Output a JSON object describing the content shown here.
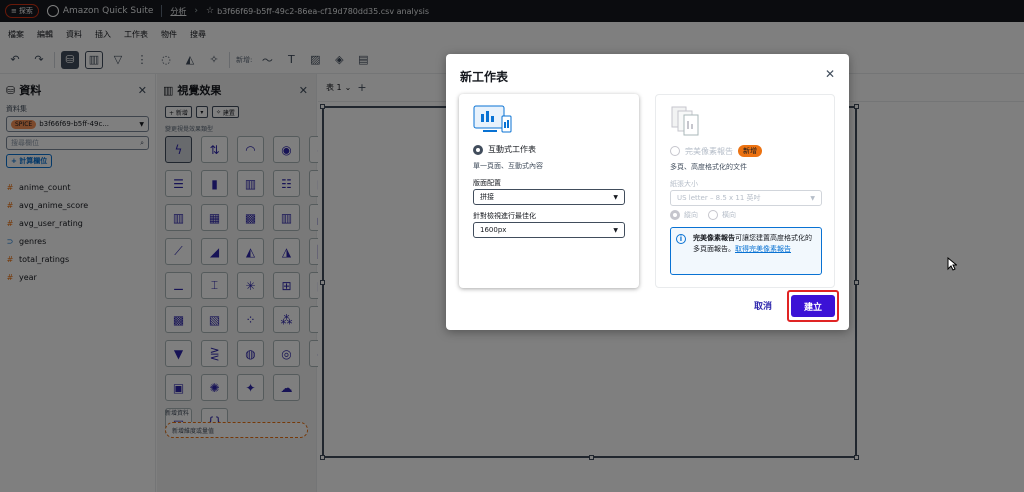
{
  "topbar": {
    "search_label": "探索",
    "brand": "Amazon Quick Suite",
    "crumb_link": "分析",
    "crumb_file": "b3f66f69-b5ff-49c2-86ea-cf19d780dd35.csv analysis"
  },
  "menubar": [
    "檔案",
    "編輯",
    "資料",
    "插入",
    "工作表",
    "物件",
    "搜尋"
  ],
  "toolbar": {
    "new_label": "新增:"
  },
  "data_panel": {
    "title": "資料",
    "dataset_label": "資料集",
    "spice": "SPICE",
    "dataset_name": "b3f66f69-b5ff-49c...",
    "search_placeholder": "搜尋欄位",
    "add_calc": "+ 計算欄位",
    "fields": [
      {
        "name": "anime_count",
        "kind": "measure"
      },
      {
        "name": "avg_anime_score",
        "kind": "measure"
      },
      {
        "name": "avg_user_rating",
        "kind": "measure"
      },
      {
        "name": "genres",
        "kind": "dimension"
      },
      {
        "name": "total_ratings",
        "kind": "measure"
      },
      {
        "name": "year",
        "kind": "measure"
      }
    ]
  },
  "visuals_panel": {
    "title": "視覺效果",
    "add_btn": "+ 新增",
    "build_btn": "建置",
    "type_label": "變更視覺效果類型",
    "new_data_label": "新增資料",
    "drop_hint": "新增維度或量值"
  },
  "canvas": {
    "sheet_tab": "表 1"
  },
  "modal": {
    "title": "新工作表",
    "interactive": {
      "label": "互動式工作表",
      "desc": "單一頁面、互動式內容",
      "layout_label": "版面配置",
      "layout_value": "拼接",
      "optimize_label": "針對檢視進行最佳化",
      "optimize_value": "1600px"
    },
    "pixel": {
      "label": "完美像素報告",
      "badge": "新增",
      "desc": "多頁、高度格式化的文件",
      "paper_label": "紙張大小",
      "paper_value": "US letter – 8.5 x 11 英吋",
      "portrait": "縱向",
      "landscape": "橫向",
      "info_bold": "完美像素報告",
      "info_text": "可讓您建置高度格式化的多頁面報告。",
      "info_link": "取得完美像素報告"
    },
    "cancel": "取消",
    "create": "建立"
  }
}
